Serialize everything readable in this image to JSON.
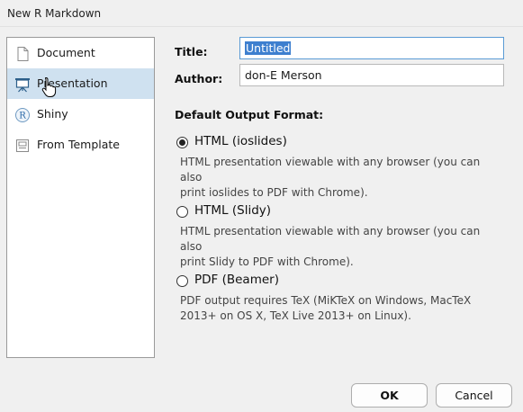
{
  "window": {
    "title": "New R Markdown"
  },
  "sidebar": {
    "items": [
      {
        "label": "Document",
        "icon": "document-icon"
      },
      {
        "label": "Presentation",
        "icon": "presentation-icon",
        "selected": true
      },
      {
        "label": "Shiny",
        "icon": "shiny-icon"
      },
      {
        "label": "From Template",
        "icon": "template-icon"
      }
    ]
  },
  "form": {
    "title_label": "Title:",
    "title_value": "Untitled",
    "author_label": "Author:",
    "author_value": "don-E Merson"
  },
  "output": {
    "heading": "Default Output Format:",
    "options": [
      {
        "label": "HTML (ioslides)",
        "selected": true,
        "desc_line1": "HTML presentation viewable with any browser (you can also",
        "desc_line2": "print ioslides to PDF with Chrome)."
      },
      {
        "label": "HTML (Slidy)",
        "selected": false,
        "desc_line1": "HTML presentation viewable with any browser (you can also",
        "desc_line2": "print Slidy to PDF with Chrome)."
      },
      {
        "label": "PDF (Beamer)",
        "selected": false,
        "desc_line1": "PDF output requires TeX (MiKTeX on Windows, MacTeX",
        "desc_line2": "2013+ on OS X, TeX Live 2013+ on Linux)."
      }
    ]
  },
  "buttons": {
    "ok": "OK",
    "cancel": "Cancel"
  },
  "colors": {
    "selection": "#cfe1f0",
    "text_selection": "#3d7fcf",
    "focus_border": "#5a9bd5"
  }
}
